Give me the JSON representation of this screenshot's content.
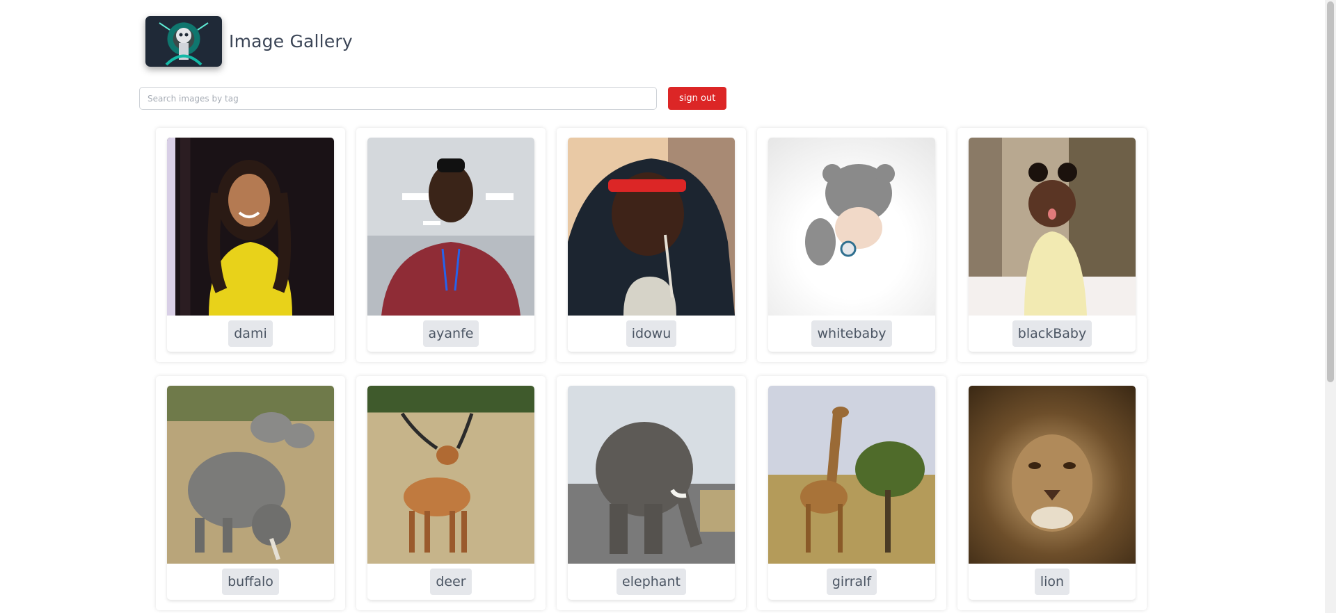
{
  "app": {
    "title": "Image Gallery"
  },
  "search": {
    "placeholder": "Search images by tag",
    "value": ""
  },
  "actions": {
    "signout_label": "sign out"
  },
  "images": [
    {
      "tag": "dami",
      "icon": "photo-person-icon"
    },
    {
      "tag": "ayanfe",
      "icon": "photo-person-icon"
    },
    {
      "tag": "idowu",
      "icon": "photo-person-icon"
    },
    {
      "tag": "whitebaby",
      "icon": "photo-baby-icon"
    },
    {
      "tag": "blackBaby",
      "icon": "photo-baby-icon"
    },
    {
      "tag": "buffalo",
      "icon": "photo-animal-icon"
    },
    {
      "tag": "deer",
      "icon": "photo-animal-icon"
    },
    {
      "tag": "elephant",
      "icon": "photo-animal-icon"
    },
    {
      "tag": "girralf",
      "icon": "photo-animal-icon"
    },
    {
      "tag": "lion",
      "icon": "photo-animal-icon"
    }
  ],
  "colors": {
    "signout_bg": "#dc2626",
    "tag_bg": "#e5e7eb",
    "title": "#3b4556"
  }
}
